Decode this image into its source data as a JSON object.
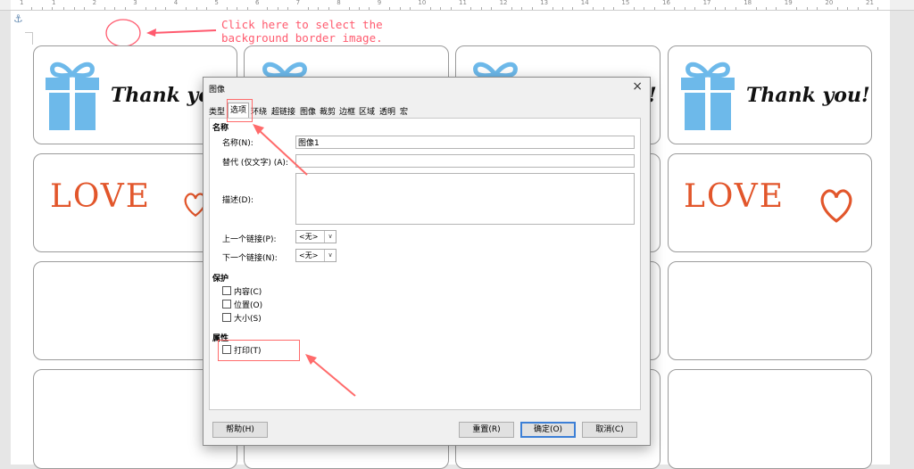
{
  "ruler": {
    "numbers": [
      "1",
      "1",
      "2",
      "3",
      "4",
      "5",
      "6",
      "7",
      "8",
      "9",
      "10",
      "11",
      "12",
      "13",
      "14",
      "15",
      "16",
      "17",
      "18",
      "19",
      "20",
      "21"
    ]
  },
  "annotation": {
    "line1": "Click here to select the",
    "line2": "background border image."
  },
  "cards": {
    "thank_you": "Thank you!",
    "thank_you_partial": "Thank yo",
    "love_text": "LOVE"
  },
  "dialog": {
    "title": "图像",
    "tabs": [
      "类型",
      "选项",
      "环绕",
      "超链接",
      "图像",
      "裁剪",
      "边框",
      "区域",
      "透明",
      "宏"
    ],
    "sections": {
      "name": "名称",
      "protect": "保护",
      "properties": "属性"
    },
    "labels": {
      "name": "名称(N):",
      "alt": "替代 (仅文字) (A):",
      "desc": "描述(D):",
      "prev_link": "上一个链接(P):",
      "next_link": "下一个链接(N):"
    },
    "values": {
      "name": "图像1",
      "alt": "",
      "desc": "",
      "prev_link": "<无>",
      "next_link": "<无>"
    },
    "protect": [
      "内容(C)",
      "位置(O)",
      "大小(S)"
    ],
    "print": "打印(T)",
    "buttons": {
      "help": "帮助(H)",
      "reset": "重置(R)",
      "ok": "确定(O)",
      "cancel": "取消(C)"
    }
  },
  "colors": {
    "annotation": "#ff5a6e",
    "gift": "#6db9ea",
    "love": "#e2562b",
    "default_button_border": "#3c7fd6"
  }
}
